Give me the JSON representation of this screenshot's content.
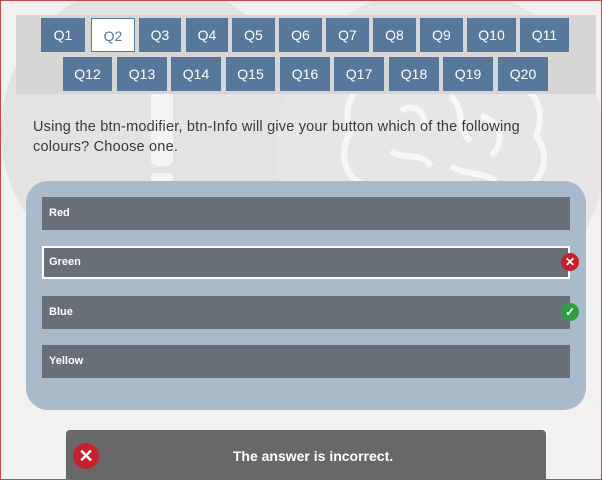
{
  "nav": {
    "row1": [
      "Q1",
      "Q2",
      "Q3",
      "Q4",
      "Q5",
      "Q6",
      "Q7",
      "Q8",
      "Q9",
      "Q10",
      "Q11"
    ],
    "row2": [
      "Q12",
      "Q13",
      "Q14",
      "Q15",
      "Q16",
      "Q17",
      "Q18",
      "Q19",
      "Q20"
    ],
    "active": "Q2"
  },
  "question": {
    "text": "Using the btn-modifier, btn-Info will give your button which of the following colours? Choose one."
  },
  "options": [
    {
      "label": "Red",
      "state": "none"
    },
    {
      "label": "Green",
      "state": "selected-wrong"
    },
    {
      "label": "Blue",
      "state": "correct"
    },
    {
      "label": "Yellow",
      "state": "none"
    }
  ],
  "feedback": {
    "text": "The answer is incorrect.",
    "status": "incorrect"
  },
  "colors": {
    "nav_button": "#58789b",
    "panel": "#a9bacb",
    "option": "#686f78",
    "wrong": "#c8212e",
    "correct": "#2e9e3f",
    "feedback_bg": "#686868"
  },
  "icons": {
    "background": "brain-icon",
    "wrong": "close-icon",
    "correct": "check-icon"
  }
}
